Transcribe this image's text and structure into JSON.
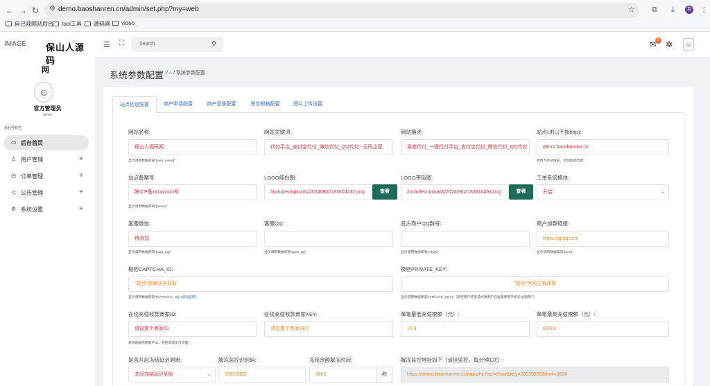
{
  "browser": {
    "url": "demo.baoshanren.cn/admin/set.php?my=web",
    "bookmarks": [
      "自己观网站后台",
      "tool工具",
      "源码网",
      "video"
    ],
    "profile_initial": "百"
  },
  "sidebar": {
    "logo_alt": "IMAGE",
    "site_name": "保山人源码",
    "site_name_tail": "网",
    "admin_name": "官方管理员",
    "admin_role": "admin",
    "nav_title": "后台导航栏",
    "items": [
      {
        "label": "后台首页",
        "icon": "monitor-icon",
        "glyph": "▭"
      },
      {
        "label": "用户管理",
        "icon": "user-icon",
        "glyph": "♙"
      },
      {
        "label": "订单管理",
        "icon": "clock-icon",
        "glyph": "◷"
      },
      {
        "label": "公告管理",
        "icon": "megaphone-icon",
        "glyph": "◁"
      },
      {
        "label": "系统设置",
        "icon": "gear-icon",
        "glyph": "⚙"
      }
    ]
  },
  "topbar": {
    "search_placeholder": "Search",
    "mail_count": "0"
  },
  "page": {
    "title": "系统参数配置",
    "breadcrumb_sep": "/",
    "breadcrumb_current": "系统参数配置"
  },
  "tabs": [
    "站点信息配置",
    "商户申请配置",
    "商户登录配置",
    "短信邮箱配置",
    "图片上传设置"
  ],
  "form": {
    "web_name": {
      "label": "网站名称:",
      "value": "保山人源码网",
      "hint": "显示调用数据库表\"[web_name]\""
    },
    "web_keywords": {
      "label": "网站关键词:",
      "value": "代付平台_支付宝代付_微信代付_QQ代付 - 云码之家"
    },
    "web_desc": {
      "label": "网站描述:",
      "value": "易商代付_一键代付平台_支付宝代付_微信代付_QQ代付"
    },
    "site_url": {
      "label": "站点URL(不加http):",
      "value": "demo.baoshanren.cn",
      "hint": "修改为本站域名，否则回调出错"
    },
    "beian": {
      "label": "站点备案号:",
      "value": "陕ICP备xxxxxxxxx号",
      "hint": "显示调用数据库表\"[beian]\""
    },
    "logo_white": {
      "label": "LOGO纯白图:",
      "value": "/includes/uploads/20240902183804232.png",
      "button": "查看"
    },
    "logo_color": {
      "label": "LOGO带色图:",
      "value": "/includes/uploads/20240902183810454.png",
      "button": "查看"
    },
    "ticket_module": {
      "label": "工单系统模块:",
      "value": "开启"
    },
    "wechat": {
      "label": "客服微信:",
      "value": "待添加",
      "hint": "显示调用数据库表\"[web_qq]\""
    },
    "qq": {
      "label": "客服QQ:",
      "value": "",
      "hint": "显示调用数据库表\"[web_qq]\""
    },
    "qq_group": {
      "label": "官方商户QQ群号:",
      "value": "",
      "hint": "显示调用数据库表\"[shqh]\""
    },
    "group_link": {
      "label": "商户加群链接:",
      "value": "https://jq.qq.com",
      "hint": "显示调用数据库表\"[qun]\""
    },
    "captcha_id": {
      "label": "极验CAPTCHA_ID:",
      "value": "\"极验\"官网注册获取",
      "hint": "显示调用数据库表\"[CAPTCHA_ID]\"",
      "hint_link": "(极验官网)"
    },
    "private_key": {
      "label": "极验PRIVATE_KEY:",
      "value": "\"极验\"官网注册获取",
      "hint": "显示调用数据库表\"[PRIVATE_KEY]\"（留空用户将无法修改商户信息及使用手机号注册商户）"
    },
    "pay_merchant_id": {
      "label": "在线充值收款商家ID:",
      "value": "请设置个商家ID",
      "hint": "系统收款所用商户ID，包括测试支付页面!"
    },
    "pay_merchant_key": {
      "label": "在线充值收款商家KEY:",
      "value": "请设置个商家KEY"
    },
    "min_recharge": {
      "label": "单笔最低充值限额（元）:",
      "value": "19.9"
    },
    "max_recharge": {
      "label": "单笔最高充值限额（元）:",
      "value": "60000"
    },
    "freeze_delay": {
      "label": "是否开启冻结延迟到账:",
      "value": "关闭冻结延迟到账"
    },
    "unfreeze_code": {
      "label": "解冻监控识别码:",
      "value": "20010325"
    },
    "freeze_time": {
      "label": "冻结余额解冻时间:",
      "value": "3600",
      "suffix": "秒"
    },
    "monitor_url": {
      "label": "解冻监控地址如下（请挂监控，每分钟1次）:",
      "value": "https://demo.baoshanren.cn/api.php?act=thaw&key=20010325&limit=3600"
    }
  }
}
